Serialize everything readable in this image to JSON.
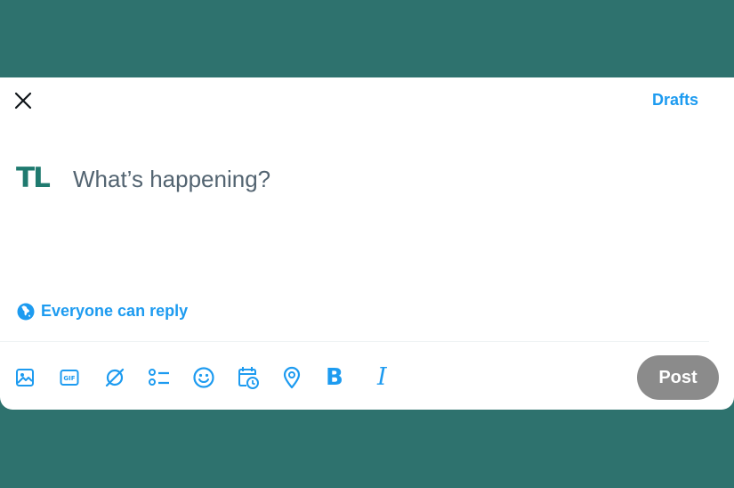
{
  "header": {
    "drafts_label": "Drafts"
  },
  "avatar": {
    "text": "TL"
  },
  "composer": {
    "placeholder": "What’s happening?"
  },
  "reply_setting": {
    "label": "Everyone can reply"
  },
  "toolbar": {
    "items": [
      "image-icon",
      "gif-icon",
      "grok-icon",
      "poll-icon",
      "emoji-icon",
      "schedule-icon",
      "location-icon",
      "bold-icon",
      "italic-icon"
    ],
    "bold_glyph": "B",
    "italic_glyph": "I",
    "gif_text": "GIF"
  },
  "post_button": {
    "label": "Post"
  },
  "colors": {
    "accent": "#1d9bf0",
    "background": "#2e726e",
    "post_disabled": "#8b8b8b",
    "avatar": "#1f7a6f"
  }
}
